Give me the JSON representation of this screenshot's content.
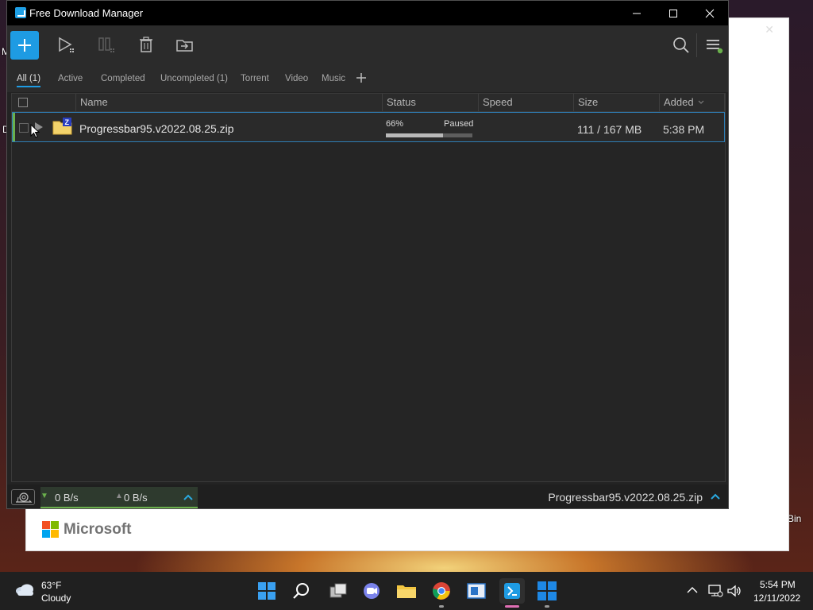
{
  "desktop": {
    "bin_label": "Bin"
  },
  "background_window": {
    "brand": "Microsoft"
  },
  "window": {
    "title": "Free Download Manager"
  },
  "filters": [
    {
      "label": "All (1)",
      "active": true
    },
    {
      "label": "Active"
    },
    {
      "label": "Completed"
    },
    {
      "label": "Uncompleted (1)"
    },
    {
      "label": "Torrent"
    },
    {
      "label": "Video"
    },
    {
      "label": "Music"
    }
  ],
  "columns": {
    "name": "Name",
    "status": "Status",
    "speed": "Speed",
    "size": "Size",
    "added": "Added"
  },
  "downloads": [
    {
      "name": "Progressbar95.v2022.08.25.zip",
      "progress_text": "66%",
      "progress": 0.66,
      "status": "Paused",
      "speed": "",
      "size": "111 / 167 MB",
      "added": "5:38 PM"
    }
  ],
  "statusbar": {
    "download_speed": "0 B/s",
    "upload_speed": "0 B/s",
    "current_file": "Progressbar95.v2022.08.25.zip"
  },
  "taskbar": {
    "weather_temp": "63°F",
    "weather_condition": "Cloudy",
    "time": "5:54 PM",
    "date": "12/11/2022"
  },
  "colors": {
    "accent": "#1e9be3",
    "progress_fill": "#b9b9b9",
    "row_accent": "#6ab04c"
  }
}
